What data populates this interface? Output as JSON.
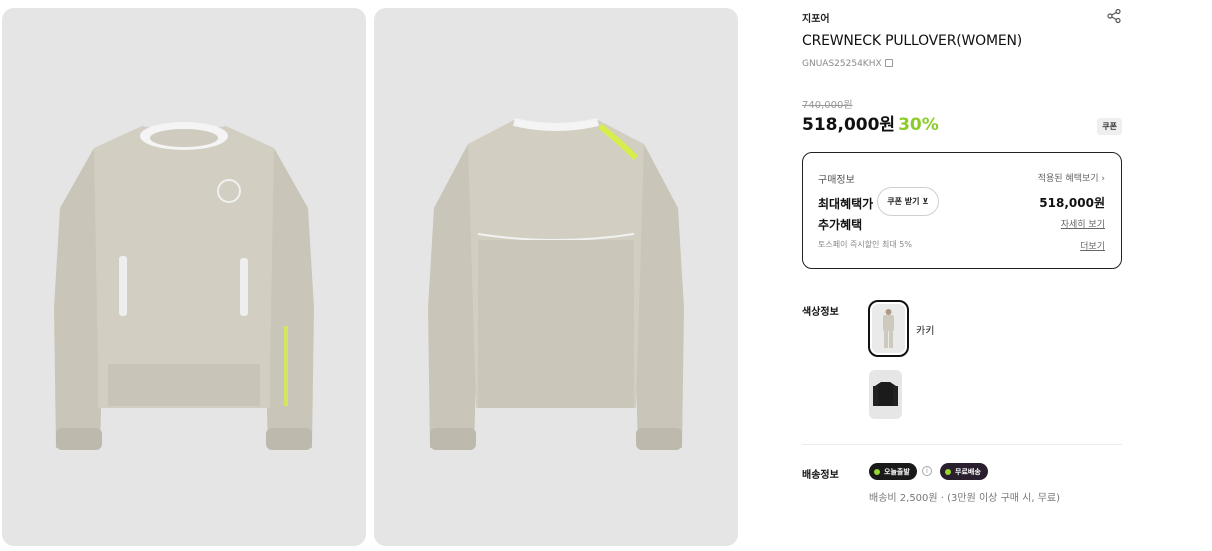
{
  "images": [
    {
      "name": "product-front",
      "alt": "front view"
    },
    {
      "name": "product-back",
      "alt": "back view"
    }
  ],
  "product": {
    "brand": "지포어",
    "title": "CREWNECK PULLOVER(WOMEN)",
    "code": "GNUAS25254KHX",
    "original_price": "740,000원",
    "price": "518,000원",
    "discount": "30%",
    "coupon_badge": "쿠폰"
  },
  "benefit": {
    "label": "구매정보",
    "applied_link": "적용된 혜택보기 ›",
    "max_label": "최대혜택가",
    "coupon_button": "쿠폰 받기 ⊻",
    "max_price": "518,000원",
    "extra_label": "추가혜택",
    "detail_link": "자세히 보기",
    "toss_text": "토스페이 즉시할인 최대 5%",
    "more_link": "더보기"
  },
  "color": {
    "label": "색상정보",
    "selected_name": "카키",
    "options": [
      "카키",
      "black"
    ]
  },
  "shipping": {
    "label": "배송정보",
    "badge_today": "오늘출발",
    "badge_free": "무료배송",
    "fee_text": "배송비 2,500원 · (3만원 이상 구매 시, 무료)"
  },
  "icons": {
    "share": "share-icon",
    "copy": "copy-icon",
    "info": "info-icon"
  },
  "colors": {
    "discount": "#8ccc2a",
    "garment": "#cfcbbf",
    "accent_yellow": "#d8f23a"
  }
}
